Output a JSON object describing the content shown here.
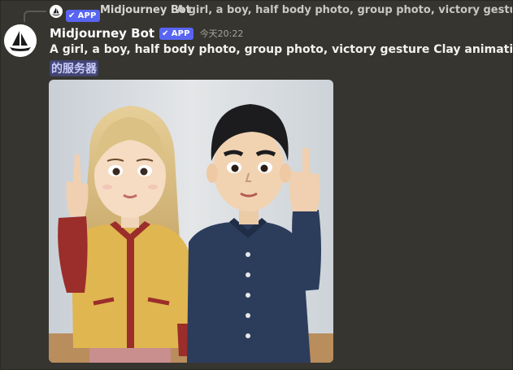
{
  "reply": {
    "author": "Midjourney Bot",
    "app_badge": "APP",
    "preview_text": "A girl, a boy, half body photo, group photo, victory gesture Clay ani"
  },
  "message": {
    "author": "Midjourney Bot",
    "app_badge": "APP",
    "timestamp": "今天20:22",
    "content": "A girl, a boy, half body photo, group photo, victory gesture Clay animation style --",
    "mention": "的服务器",
    "attachment_alt": "Clay figurines of a girl and a boy making victory gestures"
  },
  "icons": {
    "avatar": "midjourney-boat-logo",
    "badge_check": "check-icon"
  },
  "colors": {
    "background": "#36352f",
    "app_badge": "#5865f2",
    "mention_bg": "#5865f2",
    "author": "#ffffff"
  }
}
